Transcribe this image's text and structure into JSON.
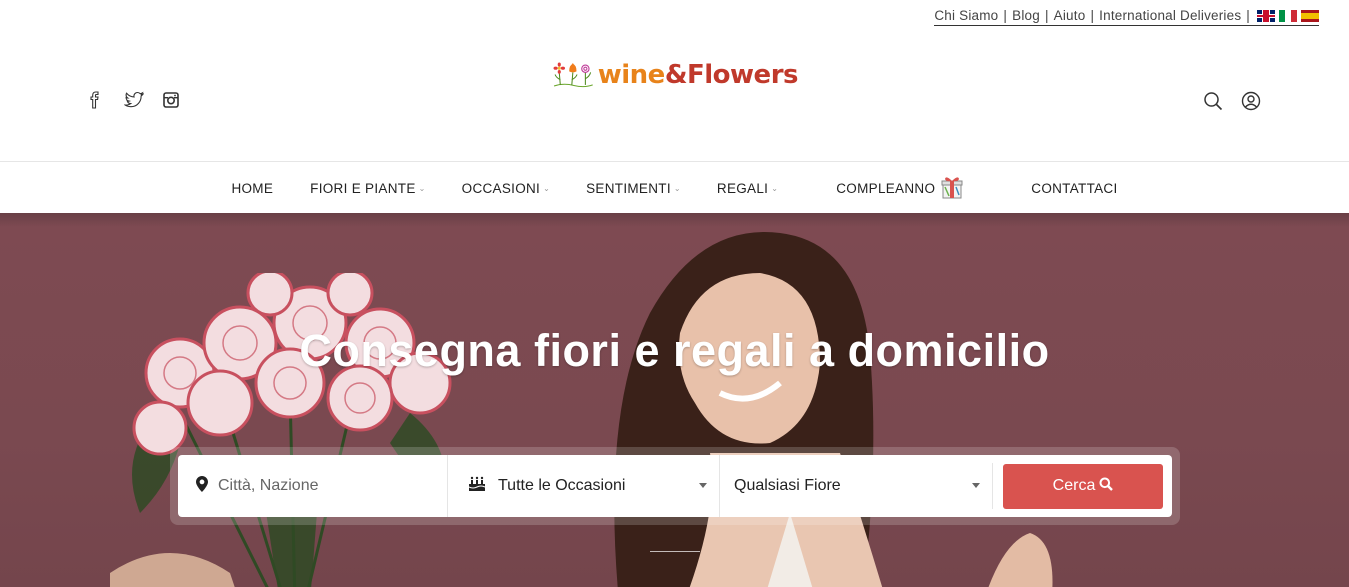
{
  "toplinks": {
    "items": [
      "Chi Siamo",
      "Blog",
      "Aiuto",
      "International Deliveries"
    ],
    "separator": "|",
    "flags": [
      "uk-flag",
      "italy-flag",
      "spain-flag"
    ]
  },
  "header": {
    "logo": {
      "word1": "wine",
      "amp": "&",
      "word2": "Flowers"
    },
    "social": [
      "facebook-icon",
      "twitter-icon",
      "instagram-icon"
    ],
    "tools": [
      "search-icon",
      "user-icon"
    ]
  },
  "nav": {
    "items": [
      {
        "label": "HOME",
        "dropdown": false
      },
      {
        "label": "FIORI E PIANTE",
        "dropdown": true
      },
      {
        "label": "OCCASIONI",
        "dropdown": true
      },
      {
        "label": "SENTIMENTI",
        "dropdown": true
      },
      {
        "label": "REGALI",
        "dropdown": true
      },
      {
        "label": "COMPLEANNO",
        "dropdown": false,
        "icon": "gift-icon"
      },
      {
        "label": "CONTATTACI",
        "dropdown": false
      }
    ],
    "caret": "⌄"
  },
  "hero": {
    "title": "Consegna fiori e regali a domicilio",
    "search": {
      "city_placeholder": "Città, Nazione",
      "occasion_value": "Tutte le Occasioni",
      "flower_value": "Qualsiasi Fiore",
      "button_label": "Cerca"
    }
  },
  "colors": {
    "accent": "#d9534f",
    "hero_bg": "#7a4950",
    "logo_orange": "#e8831a",
    "logo_red": "#c0392b"
  }
}
